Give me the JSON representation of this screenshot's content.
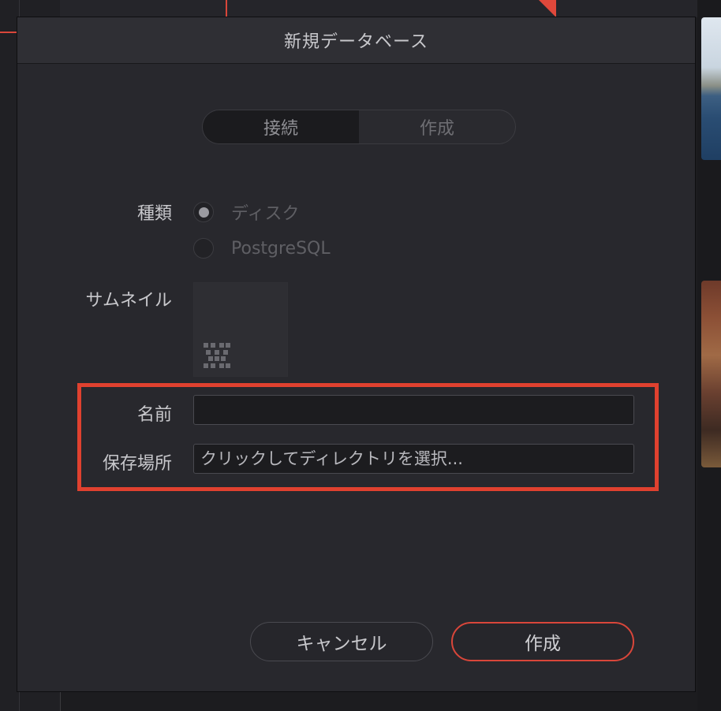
{
  "dialog": {
    "title": "新規データベース",
    "tabs": [
      {
        "label": "接続",
        "active": true
      },
      {
        "label": "作成",
        "active": false
      }
    ],
    "type_label": "種類",
    "type_options": [
      {
        "label": "ディスク",
        "selected": true
      },
      {
        "label": "PostgreSQL",
        "selected": false
      }
    ],
    "thumbnail_label": "サムネイル",
    "name_label": "名前",
    "name_value": "",
    "location_label": "保存場所",
    "location_placeholder": "クリックしてディレクトリを選択...",
    "cancel_label": "キャンセル",
    "create_label": "作成"
  },
  "colors": {
    "accent": "#e0412f",
    "dialog_bg": "#28282d",
    "text": "#c8c8cc"
  }
}
